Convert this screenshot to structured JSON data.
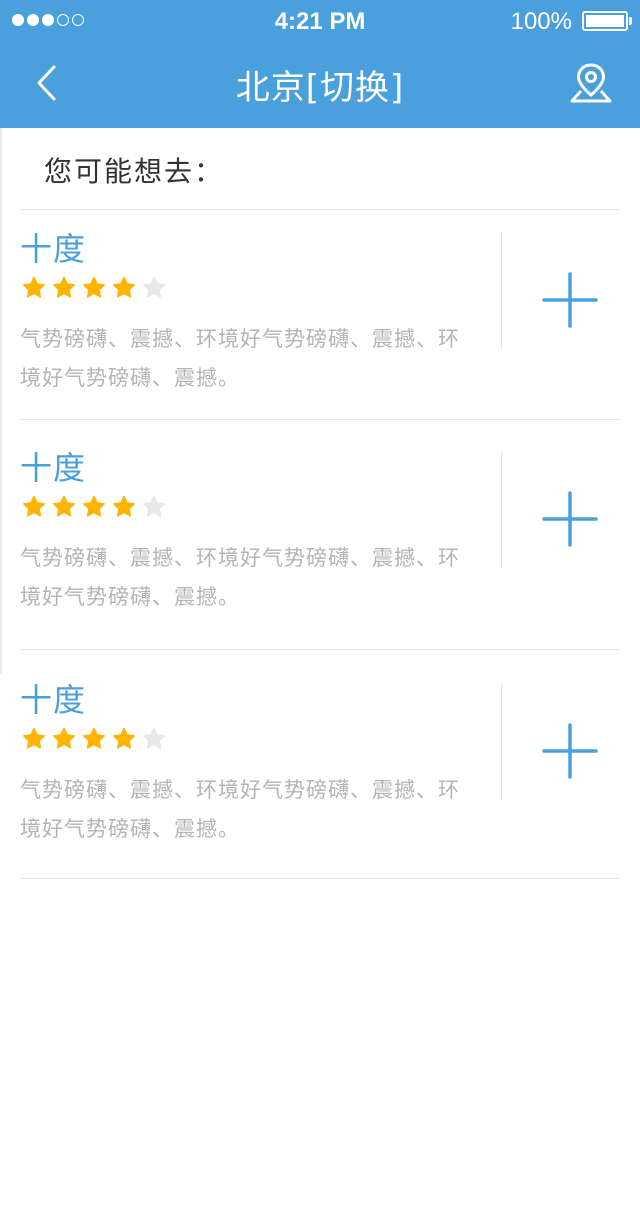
{
  "status_bar": {
    "time": "4:21 PM",
    "battery_percent": "100%",
    "signal_strength": 3,
    "signal_total": 5
  },
  "nav": {
    "title": "北京[切换]",
    "back_icon": "chevron-left-icon",
    "location_icon": "map-pin-icon"
  },
  "section_title": "您可能想去：",
  "places": [
    {
      "name": "十度",
      "rating": 4,
      "max_rating": 5,
      "description": "气势磅礴、震撼、环境好气势磅礴、震撼、环境好气势磅礴、震撼。"
    },
    {
      "name": "十度",
      "rating": 4,
      "max_rating": 5,
      "description": "气势磅礴、震撼、环境好气势磅礴、震撼、环境好气势磅礴、震撼。"
    },
    {
      "name": "十度",
      "rating": 4,
      "max_rating": 5,
      "description": "气势磅礴、震撼、环境好气势磅礴、震撼、环境好气势磅礴、震撼。"
    }
  ],
  "colors": {
    "header": "#4aa0dd",
    "accent": "#4aa0dd",
    "star_filled": "#ffb400",
    "star_empty": "#e8e8e8",
    "description_text": "#b4b4b4"
  }
}
